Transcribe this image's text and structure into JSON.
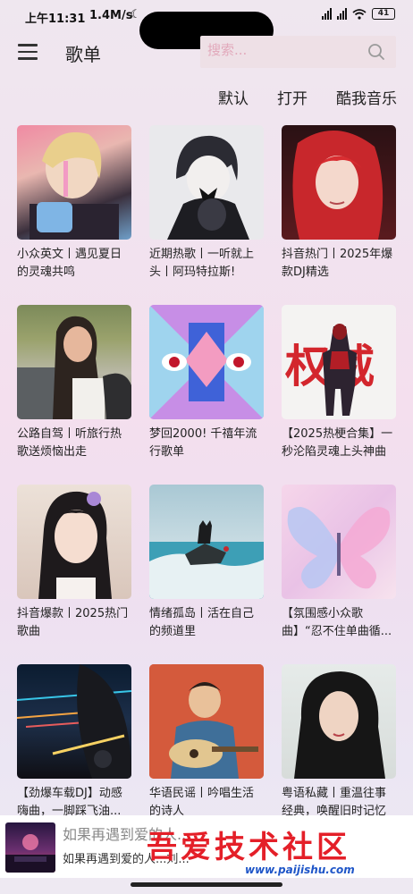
{
  "status_bar": {
    "time": "上午11:31",
    "network_speed": "1.4M/s",
    "battery": "41"
  },
  "header": {
    "title": "歌单",
    "search_placeholder": "搜索..."
  },
  "tabs": [
    "默认",
    "打开",
    "酷我音乐"
  ],
  "playlists": [
    {
      "caption": "小众英文丨遇见夏日的灵魂共鸣"
    },
    {
      "caption": "近期热歌丨一听就上头丨阿玛特拉斯!"
    },
    {
      "caption": "抖音热门丨2025年爆款DJ精选"
    },
    {
      "caption": "公路自驾丨听旅行热歌送烦恼出走"
    },
    {
      "caption": "梦回2000! 千禧年流行歌单"
    },
    {
      "caption": "【2025热梗合集】一秒沦陷灵魂上头神曲"
    },
    {
      "caption": "抖音爆款丨2025热门歌曲"
    },
    {
      "caption": "情绪孤岛丨活在自己的频道里"
    },
    {
      "caption": "【氛围感小众歌曲】“忍不住单曲循..."
    },
    {
      "caption": "【劲爆车载DJ】动感嗨曲，一脚踩飞油..."
    },
    {
      "caption": "华语民谣丨吟唱生活的诗人"
    },
    {
      "caption": "粤语私藏丨重温往事经典，唤醒旧时记忆"
    }
  ],
  "cover_art": {
    "2": "权威"
  },
  "player": {
    "title": "如果再遇到爱的人...",
    "lyric": "如果再遇到爱的人...刘... "
  },
  "watermark": {
    "text": "吾爱技术社区",
    "url": "www.paijishu.com"
  },
  "colors": {
    "accent": "#e41f28",
    "search_bg": "#eee0e6"
  }
}
